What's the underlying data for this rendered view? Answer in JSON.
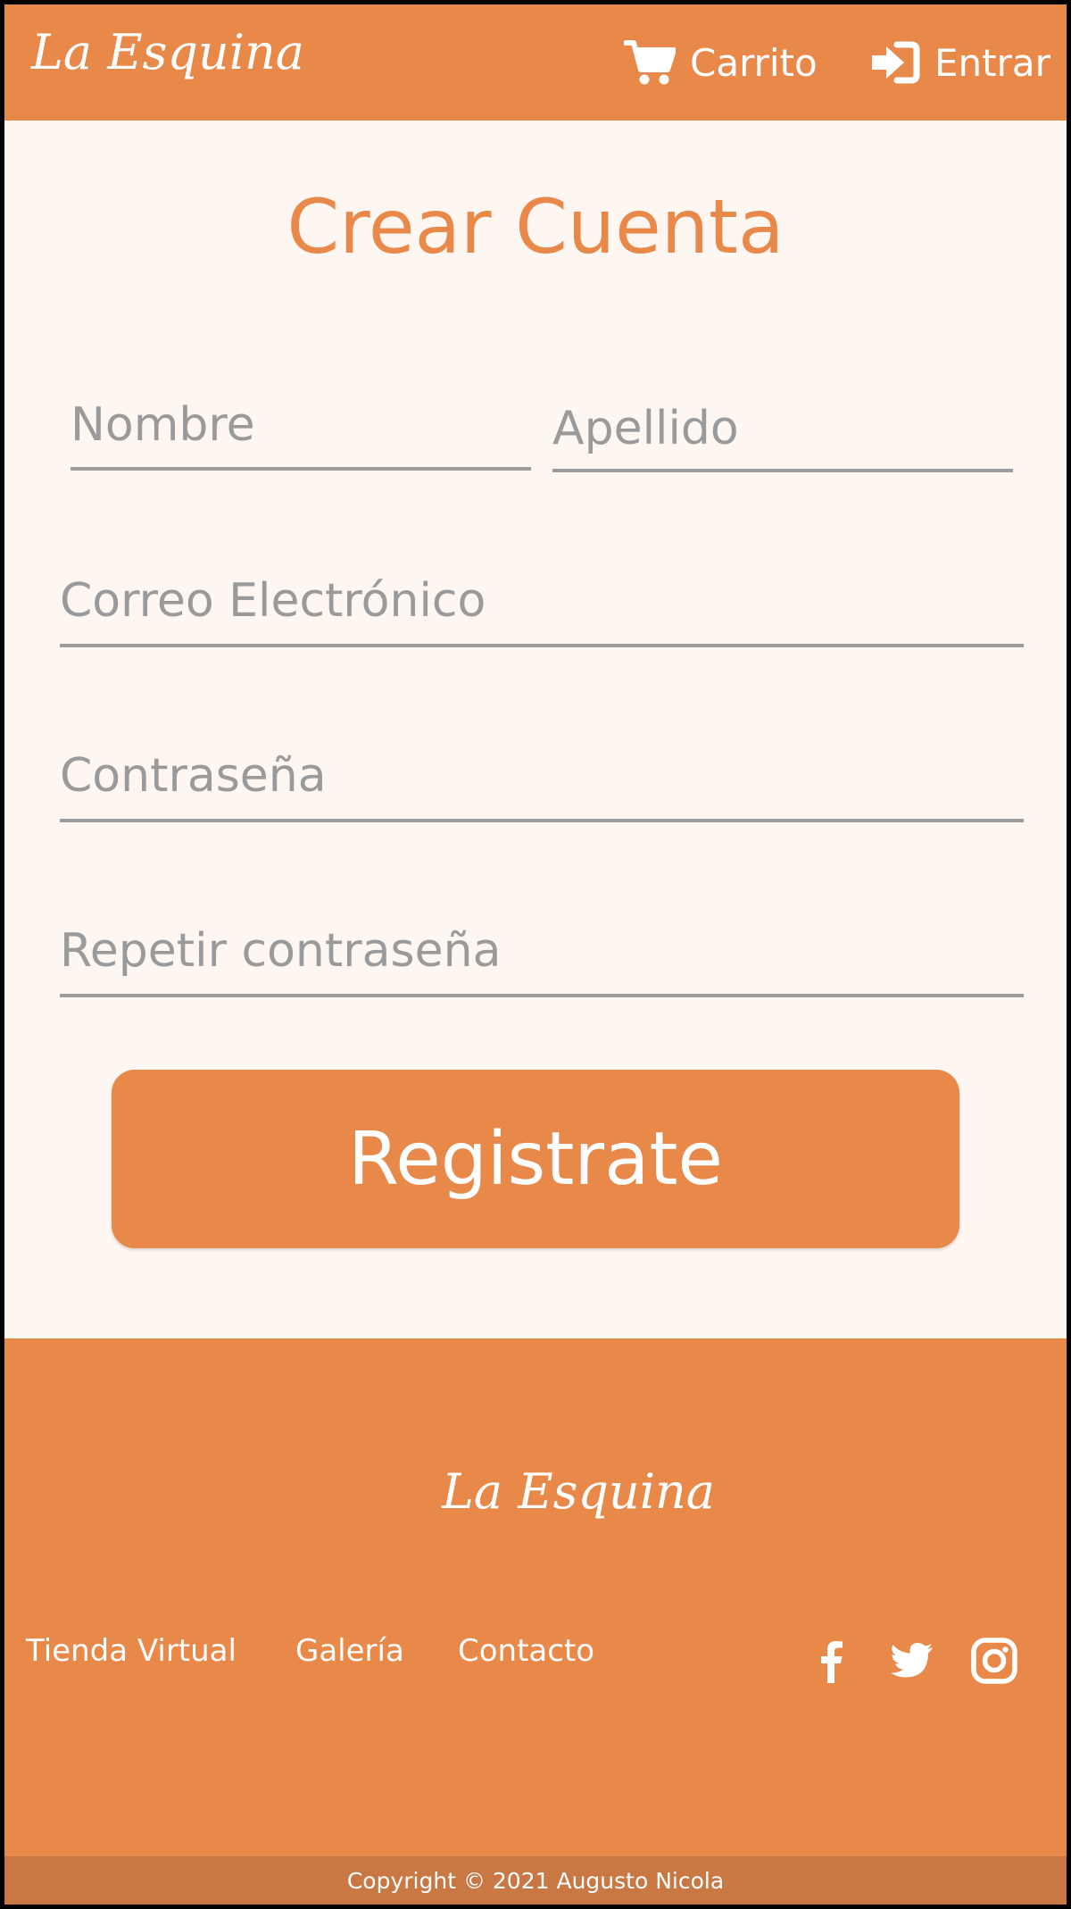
{
  "header": {
    "logo": "La Esquina",
    "nav": {
      "cart_label": "Carrito",
      "login_label": "Entrar"
    }
  },
  "form": {
    "title": "Crear Cuenta",
    "first_name_placeholder": "Nombre",
    "last_name_placeholder": "Apellido",
    "email_placeholder": "Correo Electrónico",
    "password_placeholder": "Contraseña",
    "repeat_password_placeholder": "Repetir contraseña",
    "submit_label": "Registrate"
  },
  "footer": {
    "logo": "La Esquina",
    "links": [
      "Tienda Virtual",
      "Galería",
      "Contacto"
    ],
    "social_icons": [
      "facebook-icon",
      "twitter-icon",
      "instagram-icon"
    ],
    "copyright": "Copyright © 2021 Augusto Nicola"
  },
  "colors": {
    "brand": "#e8894a",
    "background": "#fef6f1",
    "copyright_bar": "#c97743",
    "input_border": "#9d9d9d"
  }
}
